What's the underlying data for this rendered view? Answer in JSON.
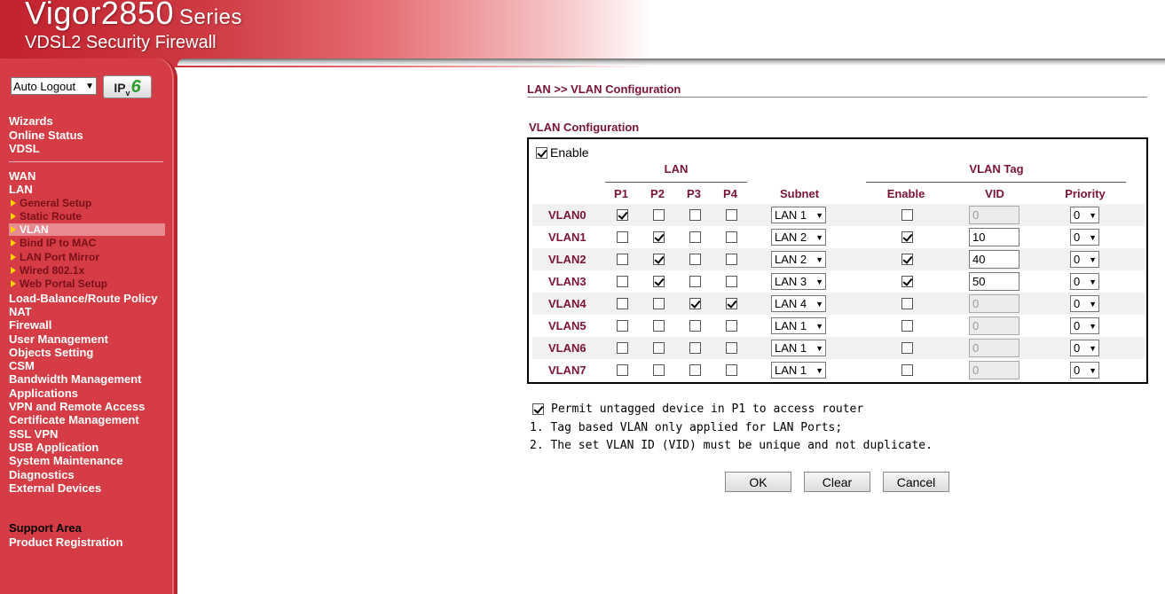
{
  "header": {
    "model": "Vigor2850",
    "series": "Series",
    "subtitle": "VDSL2 Security Firewall"
  },
  "sidebar": {
    "logout_select": "Auto Logout",
    "ipv6_button": "IPv6",
    "items_top": [
      "Wizards",
      "Online Status",
      "VDSL"
    ],
    "items_lan": [
      "WAN",
      "LAN"
    ],
    "lan_sub": [
      "General Setup",
      "Static Route",
      "VLAN",
      "Bind IP to MAC",
      "LAN Port Mirror",
      "Wired 802.1x",
      "Web Portal Setup"
    ],
    "items_rest": [
      "Load-Balance/Route Policy",
      "NAT",
      "Firewall",
      "User Management",
      "Objects Setting",
      "CSM",
      "Bandwidth Management",
      "Applications",
      "VPN and Remote Access",
      "Certificate Management",
      "SSL VPN",
      "USB Application",
      "System Maintenance",
      "Diagnostics",
      "External Devices"
    ],
    "support_area": "Support Area",
    "product_registration": "Product Registration"
  },
  "main": {
    "breadcrumb": "LAN >> VLAN Configuration",
    "section_title": "VLAN Configuration",
    "enable_label": "Enable",
    "enable_checked": true,
    "headers": {
      "lan": "LAN",
      "vlan_tag": "VLAN Tag",
      "p1": "P1",
      "p2": "P2",
      "p3": "P3",
      "p4": "P4",
      "subnet": "Subnet",
      "enable": "Enable",
      "vid": "VID",
      "priority": "Priority"
    },
    "rows": [
      {
        "name": "VLAN0",
        "p1": true,
        "p2": false,
        "p3": false,
        "p4": false,
        "subnet": "LAN 1",
        "tag_enable": false,
        "vid": "0",
        "priority": "0"
      },
      {
        "name": "VLAN1",
        "p1": false,
        "p2": true,
        "p3": false,
        "p4": false,
        "subnet": "LAN 2",
        "tag_enable": true,
        "vid": "10",
        "priority": "0"
      },
      {
        "name": "VLAN2",
        "p1": false,
        "p2": true,
        "p3": false,
        "p4": false,
        "subnet": "LAN 2",
        "tag_enable": true,
        "vid": "40",
        "priority": "0"
      },
      {
        "name": "VLAN3",
        "p1": false,
        "p2": true,
        "p3": false,
        "p4": false,
        "subnet": "LAN 3",
        "tag_enable": true,
        "vid": "50",
        "priority": "0"
      },
      {
        "name": "VLAN4",
        "p1": false,
        "p2": false,
        "p3": true,
        "p4": true,
        "subnet": "LAN 4",
        "tag_enable": false,
        "vid": "0",
        "priority": "0"
      },
      {
        "name": "VLAN5",
        "p1": false,
        "p2": false,
        "p3": false,
        "p4": false,
        "subnet": "LAN 1",
        "tag_enable": false,
        "vid": "0",
        "priority": "0"
      },
      {
        "name": "VLAN6",
        "p1": false,
        "p2": false,
        "p3": false,
        "p4": false,
        "subnet": "LAN 1",
        "tag_enable": false,
        "vid": "0",
        "priority": "0"
      },
      {
        "name": "VLAN7",
        "p1": false,
        "p2": false,
        "p3": false,
        "p4": false,
        "subnet": "LAN 1",
        "tag_enable": false,
        "vid": "0",
        "priority": "0"
      }
    ],
    "permit_label": "Permit untagged device in P1 to access router",
    "permit_checked": true,
    "note1": "1. Tag based VLAN only applied for LAN Ports;",
    "note2": "2. The set VLAN ID (VID) must be unique and not duplicate.",
    "buttons": {
      "ok": "OK",
      "clear": "Clear",
      "cancel": "Cancel"
    }
  },
  "colors": {
    "sidebar_red": "#d53c45",
    "heading_maroon": "#7a1434",
    "submenu_arrow": "#ffd200"
  }
}
